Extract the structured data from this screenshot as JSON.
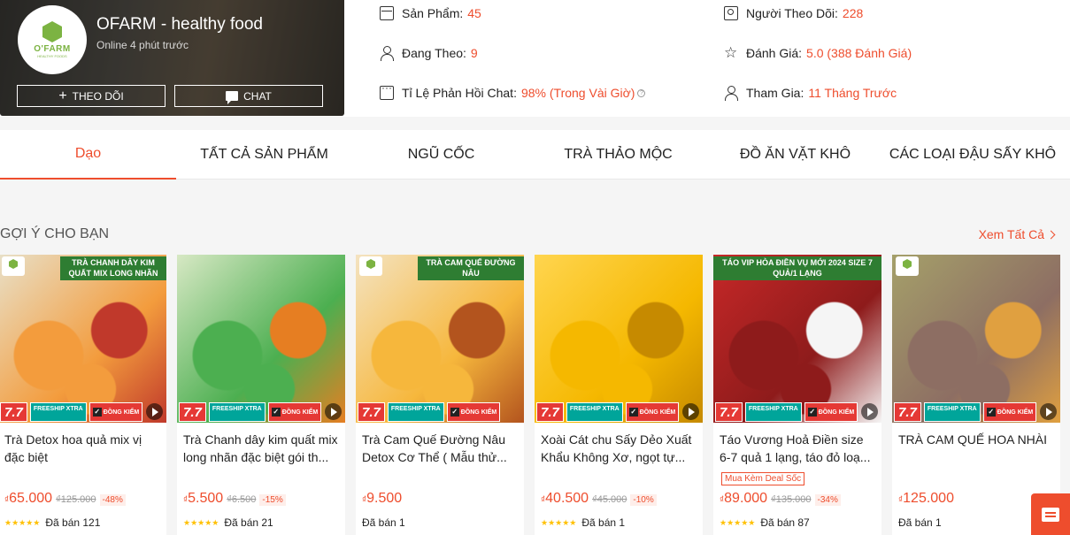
{
  "shop": {
    "name": "OFARM - healthy food",
    "online": "Online 4 phút trước",
    "logo_text": "O'FARM",
    "logo_sub": "HEALTHY FOODS",
    "follow_label": "THEO DÕI",
    "chat_label": "CHAT"
  },
  "stats": {
    "products_label": "Sản Phẩm:",
    "products_value": "45",
    "following_label": "Đang Theo:",
    "following_value": "9",
    "response_label": "Tỉ Lệ Phản Hồi Chat:",
    "response_value": "98% (Trong Vài Giờ)",
    "followers_label": "Người Theo Dõi:",
    "followers_value": "228",
    "rating_label": "Đánh Giá:",
    "rating_value": "5.0 (388 Đánh Giá)",
    "joined_label": "Tham Gia:",
    "joined_value": "11 Tháng Trước"
  },
  "tabs": [
    "Dạo",
    "TẤT CẢ SẢN PHẨM",
    "NGŨ CỐC",
    "TRÀ THẢO MỘC",
    "ĐỒ ĂN VẶT KHÔ",
    "CÁC LOẠI ĐẬU SẤY KHÔ"
  ],
  "section": {
    "title": "GỢI Ý CHO BẠN",
    "see_all": "Xem Tất Cả"
  },
  "badges": {
    "sale": "7.7",
    "freeship": "FREESHIP XTRA",
    "dongkiem": "ĐỒNG KIỂM",
    "deal": "Mua Kèm Deal Sốc"
  },
  "products": [
    {
      "name": "Trà Detox hoa quả mix vị đặc biệt",
      "price": "65.000",
      "old": "₫125.000",
      "disc": "-48%",
      "sold": "Đã bán 121",
      "banner": "TRÀ CHANH DÂY KIM QUẤT MIX LONG NHÃN",
      "colors": [
        "#f39c3d",
        "#e8e0c8",
        "#c0392b"
      ]
    },
    {
      "name": "Trà Chanh dây kim quất mix long nhãn đặc biệt gói th...",
      "price": "5.500",
      "old": "₫6.500",
      "disc": "-15%",
      "sold": "Đã bán 21",
      "banner": "",
      "colors": [
        "#4caf50",
        "#d7e8c4",
        "#e67e22"
      ]
    },
    {
      "name": "Trà Cam Quế Đường Nâu Detox Cơ Thể ( Mẫu thử...",
      "price": "9.500",
      "old": "",
      "disc": "",
      "sold": "Đã bán 1",
      "banner": "TRÀ CAM QUẾ ĐƯỜNG NÂU",
      "colors": [
        "#f6b73c",
        "#f4e3c1",
        "#b3541e"
      ]
    },
    {
      "name": "Xoài Cát chu Sấy Dẻo Xuất Khẩu Không Xơ, ngọt tự...",
      "price": "40.500",
      "old": "₫45.000",
      "disc": "-10%",
      "sold": "Đã bán 1",
      "banner": "",
      "colors": [
        "#f5b800",
        "#ffd54f",
        "#c68a00"
      ]
    },
    {
      "name": "Táo Vương Hoả Điền size 6-7 quả 1 lạng, táo đỏ loạ...",
      "price": "89.000",
      "old": "₫135.000",
      "disc": "-34%",
      "sold": "Đã bán 87",
      "banner": "TÁO VIP HÒA ĐIỀN VỤ MỚI 2024 SIZE 7 QUẢ/1 LẠNG",
      "deal": true,
      "colors": [
        "#8e1b1b",
        "#c62828",
        "#f5f5f5"
      ]
    },
    {
      "name": "TRÀ CAM QUẾ HOA NHÀI",
      "price": "125.000",
      "old": "",
      "disc": "",
      "sold": "Đã bán 1",
      "banner": "",
      "colors": [
        "#8d6e63",
        "#a5a06a",
        "#e0a040"
      ]
    }
  ]
}
